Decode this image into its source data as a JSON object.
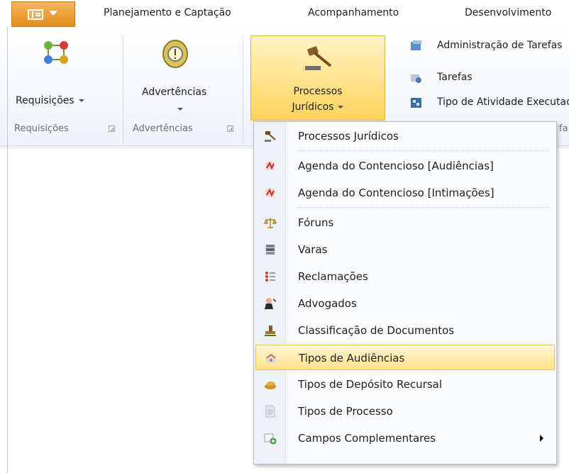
{
  "tabs": [
    "Planejamento e Captação",
    "Acompanhamento",
    "Desenvolvimento"
  ],
  "app_button": {
    "icon": "app-menu-icon"
  },
  "ribbon": {
    "requisicoes": {
      "label": "Requisições",
      "group": "Requisições"
    },
    "advertencias": {
      "label": "Advertências",
      "group": "Advertências"
    },
    "processos": {
      "label_line1": "Processos",
      "label_line2": "Jurídicos"
    },
    "small_items": [
      "Administração de Tarefas",
      "Tarefas",
      "Tipo de Atividade Executada"
    ],
    "partial_group_label": "fa"
  },
  "menu": {
    "items": [
      {
        "label": "Processos Jurídicos",
        "icon": "gavel-icon"
      },
      {
        "label": "Agenda do Contencioso [Audiências]",
        "icon": "calendar-icon"
      },
      {
        "label": "Agenda do Contencioso [Intimações]",
        "icon": "calendar-icon"
      },
      {
        "label": "Fóruns",
        "icon": "scales-icon"
      },
      {
        "label": "Varas",
        "icon": "books-icon"
      },
      {
        "label": "Reclamações",
        "icon": "list-icon"
      },
      {
        "label": "Advogados",
        "icon": "lawyer-icon"
      },
      {
        "label": "Classificação de Documentos",
        "icon": "stamp-icon"
      },
      {
        "label": "Tipos de Audiências",
        "icon": "hearing-icon"
      },
      {
        "label": "Tipos de Depósito Recursal",
        "icon": "money-icon"
      },
      {
        "label": "Tipos de Processo",
        "icon": "document-icon"
      },
      {
        "label": "Campos Complementares",
        "icon": "add-field-icon"
      }
    ],
    "highlighted": "Tipos de Audiências"
  },
  "colors": {
    "accent": "#e48f1e",
    "highlight": "#ffe08a",
    "ribbon_bg": "#eef2f7"
  }
}
